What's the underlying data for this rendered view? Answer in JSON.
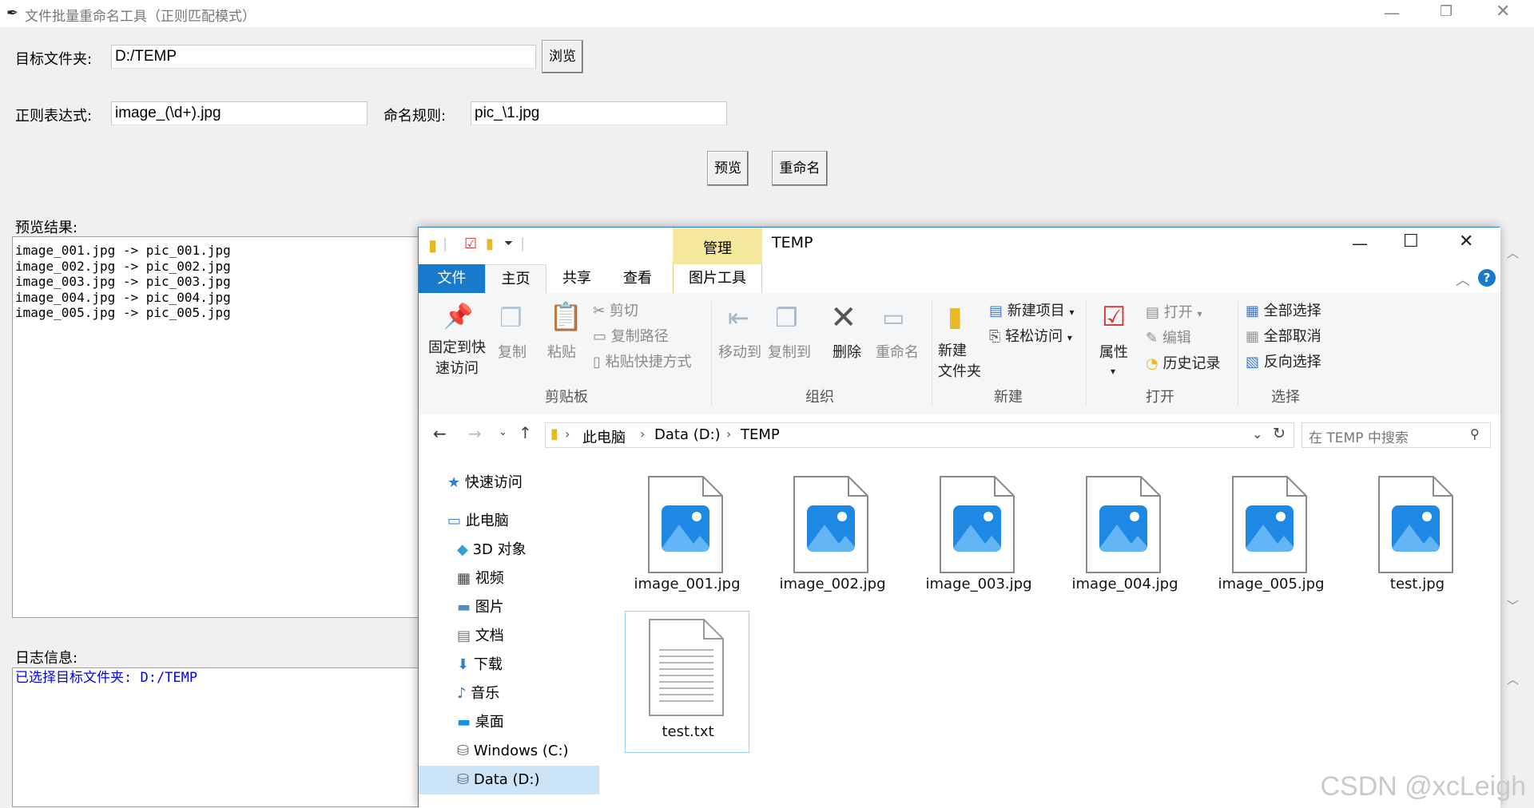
{
  "app": {
    "title": "文件批量重命名工具（正则匹配模式）",
    "target_folder_label": "目标文件夹:",
    "target_folder_value": "D:/TEMP",
    "browse_button": "浏览",
    "regex_label": "正则表达式:",
    "regex_value": "image_(\\d+).jpg",
    "rename_rule_label": "命名规则:",
    "rename_rule_value": "pic_\\1.jpg",
    "preview_button": "预览",
    "rename_button": "重命名",
    "preview_result_label": "预览结果:",
    "preview_lines": [
      "image_001.jpg -> pic_001.jpg",
      "image_002.jpg -> pic_002.jpg",
      "image_003.jpg -> pic_003.jpg",
      "image_004.jpg -> pic_004.jpg",
      "image_005.jpg -> pic_005.jpg"
    ],
    "log_label": "日志信息:",
    "log_line": "已选择目标文件夹: D:/TEMP",
    "log_color": "#0000ff"
  },
  "explorer": {
    "title": "TEMP",
    "manage_tab": "管理",
    "picture_tools_tab": "图片工具",
    "tabs": {
      "file": "文件",
      "home": "主页",
      "share": "共享",
      "view": "查看"
    },
    "clipboard": {
      "pin": [
        "固定到快",
        "速访问"
      ],
      "copy": "复制",
      "paste": "粘贴",
      "cut": "剪切",
      "copy_path": "复制路径",
      "paste_shortcut": "粘贴快捷方式",
      "group": "剪贴板"
    },
    "organize": {
      "move_to": "移动到",
      "copy_to": "复制到",
      "delete": "删除",
      "rename": "重命名",
      "group": "组织"
    },
    "new": {
      "new_folder": [
        "新建",
        "文件夹"
      ],
      "new_item": "新建项目",
      "easy_access": "轻松访问",
      "group": "新建"
    },
    "open": {
      "properties": "属性",
      "open": "打开",
      "edit": "编辑",
      "history": "历史记录",
      "group": "打开"
    },
    "select": {
      "select_all": "全部选择",
      "select_none": "全部取消",
      "invert": "反向选择",
      "group": "选择"
    },
    "breadcrumb": [
      "此电脑",
      "Data (D:)",
      "TEMP"
    ],
    "search_placeholder": "在 TEMP 中搜索",
    "nav_items": {
      "quick_access": "快速访问",
      "this_pc": "此电脑",
      "objects_3d": "3D 对象",
      "videos": "视频",
      "pictures": "图片",
      "documents": "文档",
      "downloads": "下载",
      "music": "音乐",
      "desktop": "桌面",
      "drive_c": "Windows (C:)",
      "drive_d": "Data (D:)"
    },
    "files": [
      "image_001.jpg",
      "image_002.jpg",
      "image_003.jpg",
      "image_004.jpg",
      "image_005.jpg",
      "test.jpg",
      "test.txt"
    ]
  },
  "watermark": "CSDN @xcLeigh"
}
